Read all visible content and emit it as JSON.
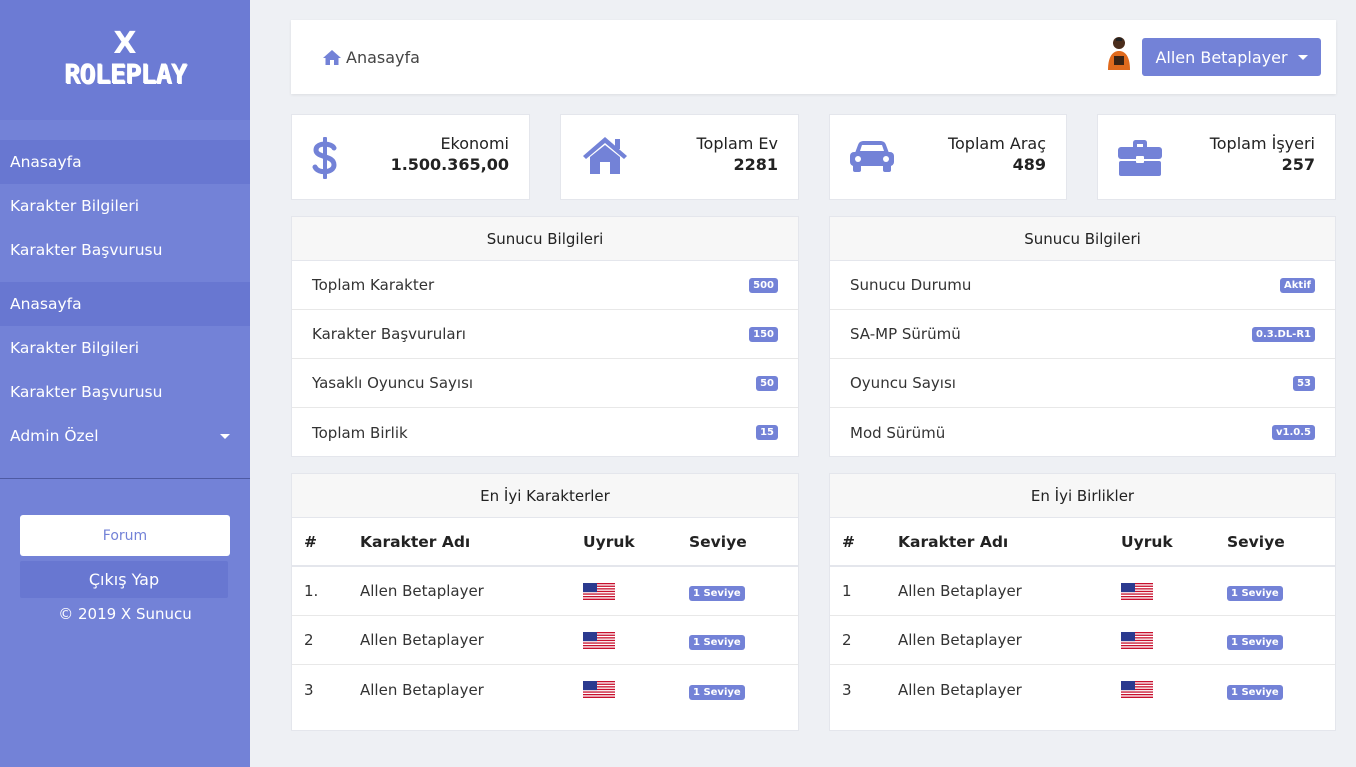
{
  "brand": {
    "logo_top": "X",
    "logo_main": "ROLEPLAY"
  },
  "sidebar": {
    "items": [
      {
        "label": "Anasayfa"
      },
      {
        "label": "Karakter Bilgileri"
      },
      {
        "label": "Karakter Başvurusu"
      },
      {
        "label": "Anasayfa"
      },
      {
        "label": "Karakter Bilgileri"
      },
      {
        "label": "Karakter Başvurusu"
      },
      {
        "label": "Admin Özel"
      }
    ],
    "forum_label": "Forum",
    "logout_label": "Çıkış Yap",
    "copyright": "© 2019 X Sunucu"
  },
  "header": {
    "breadcrumb": "Anasayfa",
    "user_name": "Allen Betaplayer"
  },
  "stats": [
    {
      "label": "Ekonomi",
      "value": "1.500.365,00",
      "icon": "dollar-icon"
    },
    {
      "label": "Toplam Ev",
      "value": "2281",
      "icon": "home-icon"
    },
    {
      "label": "Toplam Araç",
      "value": "489",
      "icon": "car-icon"
    },
    {
      "label": "Toplam İşyeri",
      "value": "257",
      "icon": "briefcase-icon"
    }
  ],
  "server_left": {
    "title": "Sunucu Bilgileri",
    "rows": [
      {
        "label": "Toplam Karakter",
        "badge": "500"
      },
      {
        "label": "Karakter Başvuruları",
        "badge": "150"
      },
      {
        "label": "Yasaklı Oyuncu Sayısı",
        "badge": "50"
      },
      {
        "label": "Toplam Birlik",
        "badge": "15"
      }
    ]
  },
  "server_right": {
    "title": "Sunucu Bilgileri",
    "rows": [
      {
        "label": "Sunucu Durumu",
        "badge": "Aktif"
      },
      {
        "label": "SA-MP Sürümü",
        "badge": "0.3.DL-R1"
      },
      {
        "label": "Oyuncu Sayısı",
        "badge": "53"
      },
      {
        "label": "Mod Sürümü",
        "badge": "v1.0.5"
      }
    ]
  },
  "top_characters": {
    "title": "En İyi Karakterler",
    "headers": [
      "#",
      "Karakter Adı",
      "Uyruk",
      "Seviye"
    ],
    "rows": [
      {
        "rank": "1.",
        "name": "Allen Betaplayer",
        "level": "1 Seviye"
      },
      {
        "rank": "2",
        "name": "Allen Betaplayer",
        "level": "1 Seviye"
      },
      {
        "rank": "3",
        "name": "Allen Betaplayer",
        "level": "1 Seviye"
      }
    ]
  },
  "top_groups": {
    "title": "En İyi Birlikler",
    "headers": [
      "#",
      "Karakter Adı",
      "Uyruk",
      "Seviye"
    ],
    "rows": [
      {
        "rank": "1",
        "name": "Allen Betaplayer",
        "level": "1 Seviye"
      },
      {
        "rank": "2",
        "name": "Allen Betaplayer",
        "level": "1 Seviye"
      },
      {
        "rank": "3",
        "name": "Allen Betaplayer",
        "level": "1 Seviye"
      }
    ]
  },
  "colors": {
    "accent": "#7382d7",
    "sidebar": "#7382d7",
    "background": "#eef0f4"
  }
}
